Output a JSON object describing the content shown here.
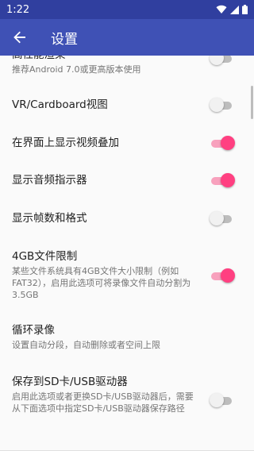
{
  "status_bar": {
    "time": "1:22"
  },
  "app_bar": {
    "title": "设置"
  },
  "settings": [
    {
      "title": "高性能渲染",
      "subtitle": "推荐Android 7.0或更高版本使用",
      "switch_on": false
    },
    {
      "title": "VR/Cardboard视图",
      "subtitle": "",
      "switch_on": false
    },
    {
      "title": "在界面上显示视频叠加",
      "subtitle": "",
      "switch_on": true
    },
    {
      "title": "显示音频指示器",
      "subtitle": "",
      "switch_on": true
    },
    {
      "title": "显示帧数和格式",
      "subtitle": "",
      "switch_on": false
    },
    {
      "title": "4GB文件限制",
      "subtitle": "某些文件系统具有4GB文件大小限制（例如FAT32），启用此选项可将录像文件自动分割为3.5GB",
      "switch_on": true
    },
    {
      "title": "循环录像",
      "subtitle": "设置自动分段，自动删除或者空间上限",
      "switch_on": null
    },
    {
      "title": "保存到SD卡/USB驱动器",
      "subtitle": "启用此选项或者更换SD卡/USB驱动器后，需要从下面选项中指定SD卡/USB驱动器保存路径",
      "switch_on": false
    }
  ],
  "colors": {
    "primary": "#3f51b5",
    "primary_dark": "#303f9f",
    "accent": "#ff4081"
  }
}
